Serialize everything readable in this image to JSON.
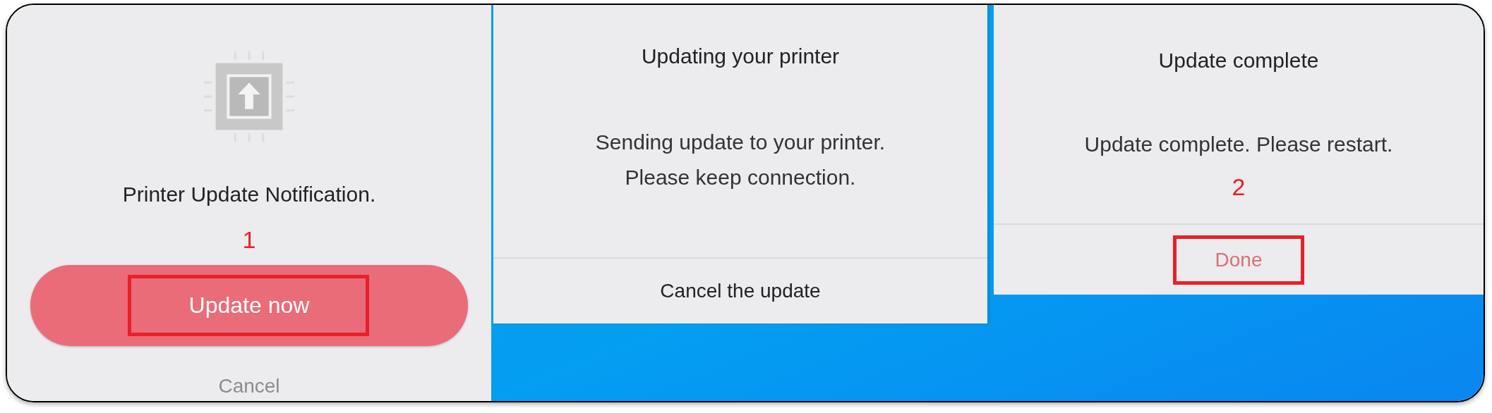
{
  "dialogs": [
    {
      "kind": "prompt",
      "message": "Printer Update Notification.",
      "annotation": "1",
      "primary_button": {
        "label": "Update now",
        "highlighted": true
      },
      "secondary_button": {
        "label": "Cancel"
      }
    },
    {
      "kind": "progress",
      "title": "Updating your printer",
      "message_lines": [
        "Sending update to your printer.",
        "Please keep connection."
      ],
      "footer_button": {
        "label": "Cancel the update",
        "highlighted": false,
        "accent": false
      }
    },
    {
      "kind": "result",
      "title": "Update complete",
      "message_lines": [
        "Update complete. Please restart."
      ],
      "annotation": "2",
      "footer_button": {
        "label": "Done",
        "highlighted": true,
        "accent": true
      }
    }
  ]
}
